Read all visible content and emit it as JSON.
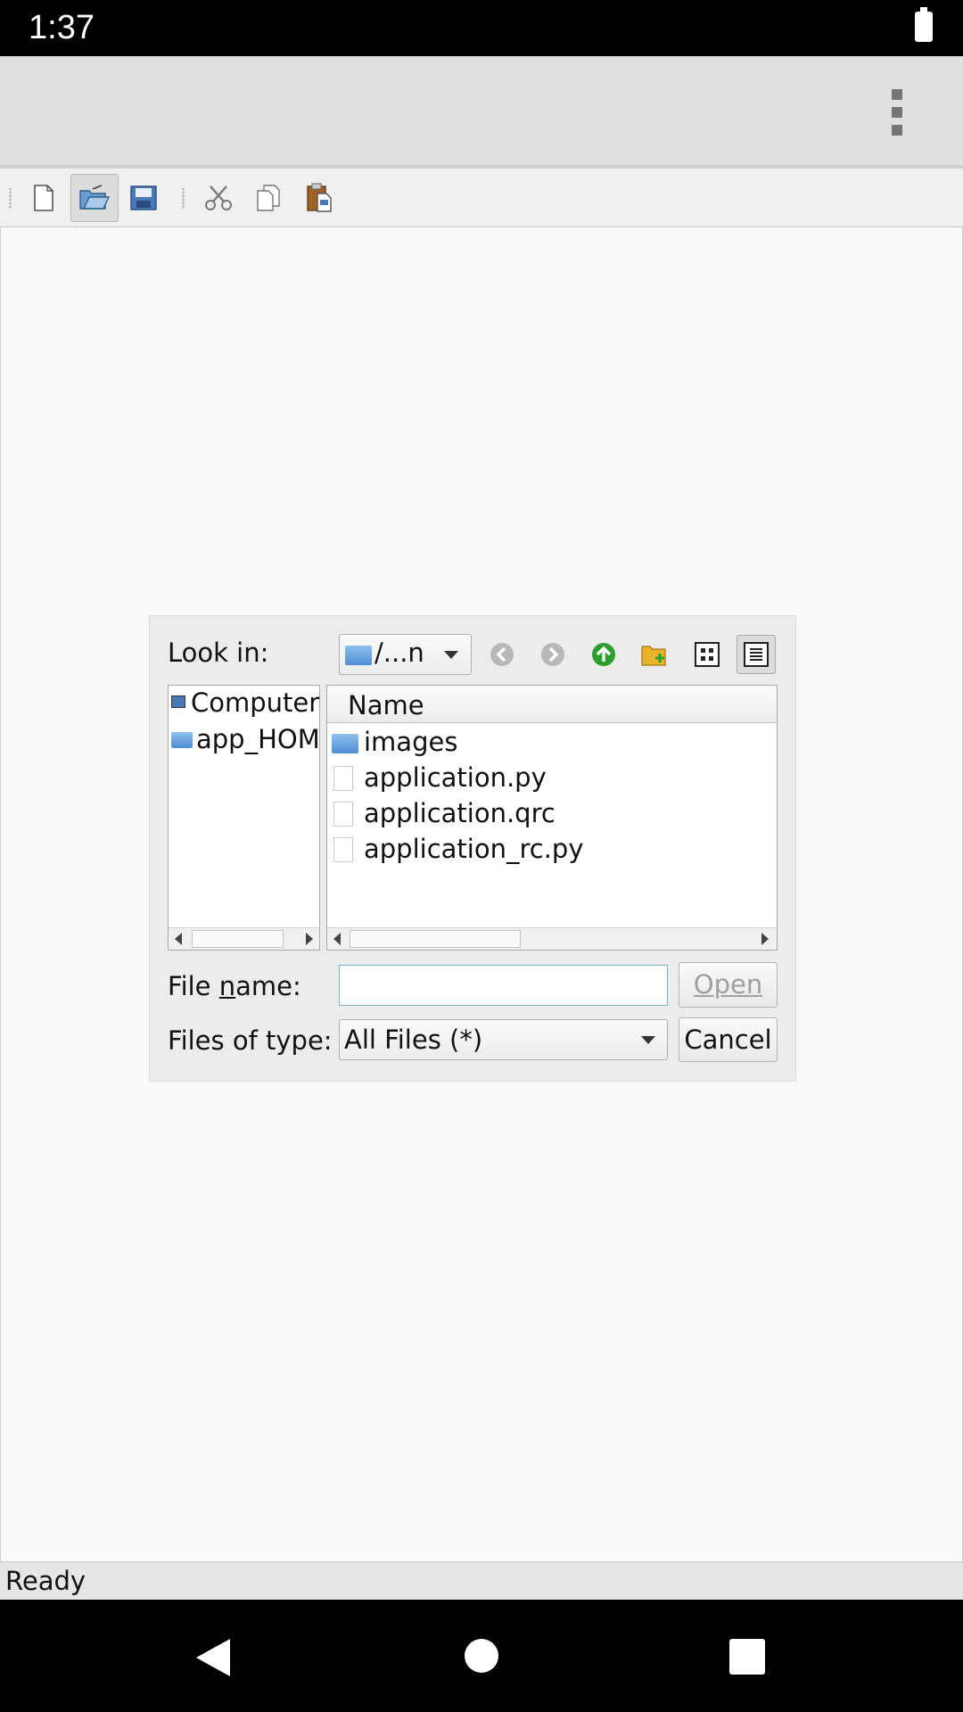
{
  "status_bar": {
    "time": "1:37"
  },
  "toolbar": {
    "buttons": [
      {
        "name": "new-file-icon"
      },
      {
        "name": "open-folder-icon"
      },
      {
        "name": "save-icon"
      },
      {
        "name": "cut-icon"
      },
      {
        "name": "copy-icon"
      },
      {
        "name": "paste-icon"
      }
    ]
  },
  "dialog": {
    "look_in_label": "Look in:",
    "look_in_value": "/...n",
    "sidebar": [
      "Computer",
      "app_HOM"
    ],
    "file_list": {
      "header": "Name",
      "items": [
        {
          "name": "images",
          "kind": "folder"
        },
        {
          "name": "application.py",
          "kind": "file"
        },
        {
          "name": "application.qrc",
          "kind": "file"
        },
        {
          "name": "application_rc.py",
          "kind": "file"
        }
      ]
    },
    "file_name_label_pre": "File ",
    "file_name_label_underlined": "n",
    "file_name_label_post": "ame:",
    "file_name_value": "",
    "files_of_type_label": "Files of type:",
    "files_of_type_value": "All Files (*)",
    "open_label": "Open",
    "cancel_label": "Cancel"
  },
  "app_status": "Ready",
  "colors": {
    "statusbar_bg": "#000000",
    "appbar_bg": "#e0e0e0",
    "dialog_bg": "#ececec",
    "up_arrow_green": "#2e9e2e",
    "folder_blue": "#4d8ed3",
    "disabled_text": "#a0a0a0"
  }
}
